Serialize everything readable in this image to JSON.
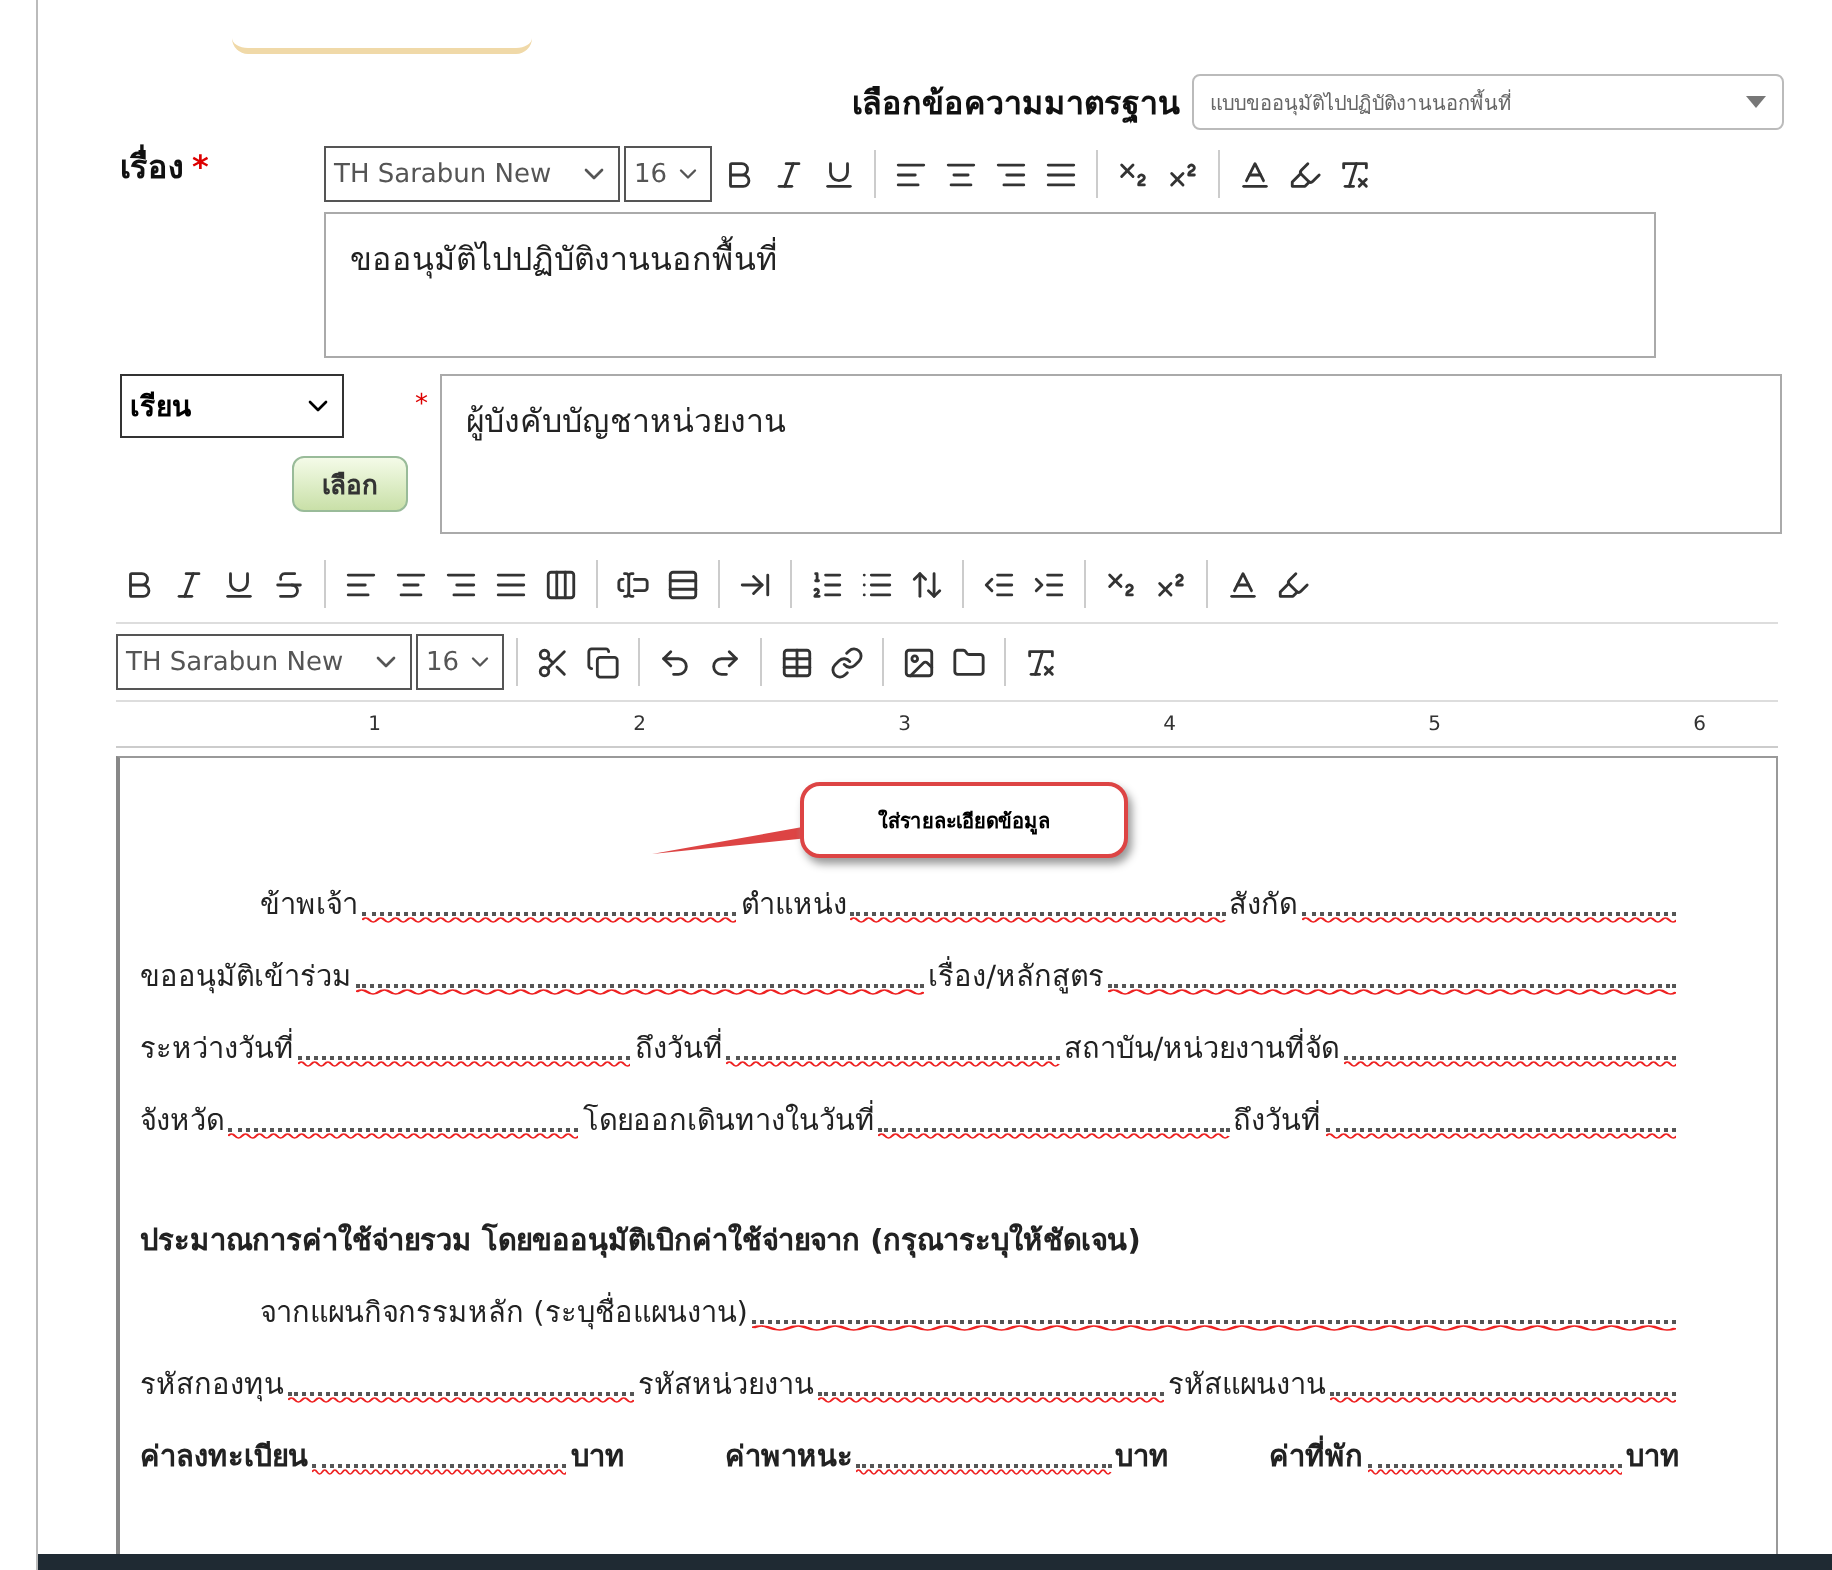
{
  "standard_text": {
    "label": "เลือกข้อความมาตรฐาน",
    "value": "แบบขออนุมัติไปปฏิบัติงานนอกพื้นที่"
  },
  "subject": {
    "label": "เรื่อง",
    "required": true,
    "required_mark": "*",
    "font": "TH Sarabun New",
    "size": "16",
    "value": "ขออนุมัติไปปฏิบัติงานนอกพื้นที่"
  },
  "recipient": {
    "salutation": "เรียน",
    "button": "เลือก",
    "required": true,
    "required_mark": "*",
    "value": "ผู้บังคับบัญชาหน่วยงาน"
  },
  "editor": {
    "font": "TH Sarabun New",
    "size": "16",
    "ruler": [
      "1",
      "2",
      "3",
      "4",
      "5",
      "6"
    ],
    "callout": "ใส่รายละเอียดข้อมูล",
    "lines": [
      {
        "kind": "fields",
        "indent": true,
        "bold": false,
        "segments": [
          {
            "kind": "text",
            "text": "ข้าพเจ้า"
          },
          {
            "kind": "blank"
          },
          {
            "kind": "text",
            "text": "ตำแหน่ง"
          },
          {
            "kind": "blank"
          },
          {
            "kind": "text",
            "text": "สังกัด"
          },
          {
            "kind": "blank"
          }
        ]
      },
      {
        "kind": "fields",
        "indent": false,
        "bold": false,
        "segments": [
          {
            "kind": "text",
            "text": "ขออนุมัติเข้าร่วม"
          },
          {
            "kind": "blank"
          },
          {
            "kind": "text",
            "text": "เรื่อง/หลักสูตร"
          },
          {
            "kind": "blank"
          }
        ]
      },
      {
        "kind": "fields",
        "indent": false,
        "bold": false,
        "segments": [
          {
            "kind": "text",
            "text": "ระหว่างวันที่"
          },
          {
            "kind": "blank"
          },
          {
            "kind": "text",
            "text": "ถึงวันที่"
          },
          {
            "kind": "blank"
          },
          {
            "kind": "text",
            "text": "สถาบัน/หน่วยงานที่จัด"
          },
          {
            "kind": "blank"
          }
        ]
      },
      {
        "kind": "fields",
        "indent": false,
        "bold": false,
        "segments": [
          {
            "kind": "text",
            "text": "จังหวัด"
          },
          {
            "kind": "blank"
          },
          {
            "kind": "text",
            "text": "โดยออกเดินทางในวันที่"
          },
          {
            "kind": "blank"
          },
          {
            "kind": "text",
            "text": "ถึงวันที่"
          },
          {
            "kind": "blank"
          }
        ]
      },
      {
        "kind": "heading",
        "indent": false,
        "bold": true,
        "segments": [
          {
            "kind": "text",
            "text": "ประมาณการค่าใช้จ่ายรวม  โดยขออนุมัติเบิกค่าใช้จ่ายจาก (กรุณาระบุให้ชัดเจน)"
          }
        ]
      },
      {
        "kind": "fields",
        "indent": true,
        "bold": false,
        "segments": [
          {
            "kind": "text",
            "text": "จากแผนกิจกรรมหลัก (ระบุชื่อแผนงาน)"
          },
          {
            "kind": "blank"
          }
        ]
      },
      {
        "kind": "fields",
        "indent": false,
        "bold": false,
        "segments": [
          {
            "kind": "text",
            "text": "รหัสกองทุน"
          },
          {
            "kind": "blank"
          },
          {
            "kind": "text",
            "text": "รหัสหน่วยงาน"
          },
          {
            "kind": "blank"
          },
          {
            "kind": "text",
            "text": "รหัสแผนงาน"
          },
          {
            "kind": "blank"
          }
        ]
      },
      {
        "kind": "fields",
        "indent": false,
        "bold": true,
        "segments": [
          {
            "kind": "text",
            "text": "ค่าลงทะเบียน"
          },
          {
            "kind": "blank"
          },
          {
            "kind": "text",
            "text": "บาท"
          },
          {
            "kind": "gap"
          },
          {
            "kind": "text",
            "text": "ค่าพาหนะ"
          },
          {
            "kind": "blank"
          },
          {
            "kind": "text",
            "text": "บาท"
          },
          {
            "kind": "gap"
          },
          {
            "kind": "text",
            "text": "ค่าที่พัก"
          },
          {
            "kind": "blank"
          },
          {
            "kind": "text",
            "text": "บาท"
          }
        ]
      }
    ]
  }
}
